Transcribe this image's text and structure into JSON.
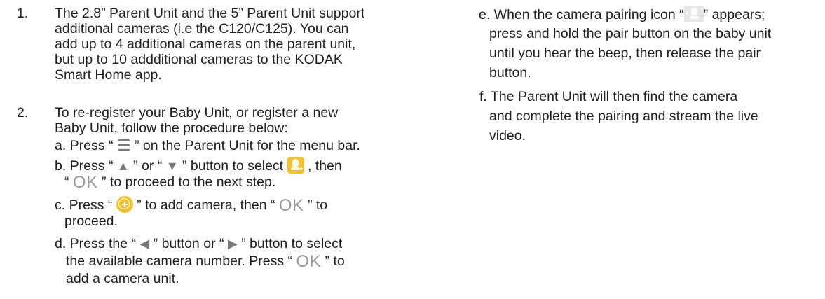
{
  "left": {
    "item1": {
      "number": "1.",
      "lines": [
        "The 2.8” Parent Unit and the 5” Parent Unit support",
        "additional cameras (i.e the C120/C125). You can",
        "add up to 4 additional cameras on the parent unit,",
        "but up to 10 addditional cameras to the KODAK",
        "Smart Home app."
      ]
    },
    "item2": {
      "number": "2.",
      "lines": [
        "To re-register your Baby Unit, or register a new",
        "Baby Unit, follow the procedure below:"
      ]
    },
    "step_a": {
      "pre": "a. Press  “ ",
      "post": " ” on the Parent Unit for the menu bar."
    },
    "step_b": {
      "pre": "b. Press  “ ",
      "mid1": " ” or “ ",
      "mid2": " ” button to select ",
      "post": " , then",
      "line2_pre": "“ ",
      "ok": "OK",
      "line2_post": " ” to proceed to the next step."
    },
    "step_c": {
      "pre": "c. Press “ ",
      "mid": " ” to add camera, then “ ",
      "ok": "OK",
      "post": " ” to",
      "line2": "proceed."
    },
    "step_d": {
      "pre": "d. Press the “ ",
      "mid": " ” button or “ ",
      "post": " ” button to select",
      "line2_pre": "the available camera number. Press “ ",
      "ok": "OK",
      "line2_post": " ” to",
      "line3": "add a camera unit."
    }
  },
  "right": {
    "step_e": {
      "pre": "e. When the camera pairing icon “",
      "post": "” appears;",
      "lines": [
        "press and hold the pair button on the baby unit",
        "until you hear the beep, then release the pair",
        "button."
      ]
    },
    "step_f": {
      "lines": [
        "f. The Parent Unit will then find the camera",
        "and complete the pairing and stream the live",
        "video."
      ]
    }
  },
  "icons": {
    "menu": "menu-icon",
    "up": "up-triangle-icon",
    "down": "down-triangle-icon",
    "left": "left-triangle-icon",
    "right": "right-triangle-icon",
    "add_camera": "add-camera-icon",
    "add_circle": "add-circle-icon",
    "pairing": "camera-pairing-icon"
  },
  "colors": {
    "icon_yellow": "#f6c12a",
    "text": "#1f1f1f",
    "ok_gray": "#9a9a9a"
  }
}
